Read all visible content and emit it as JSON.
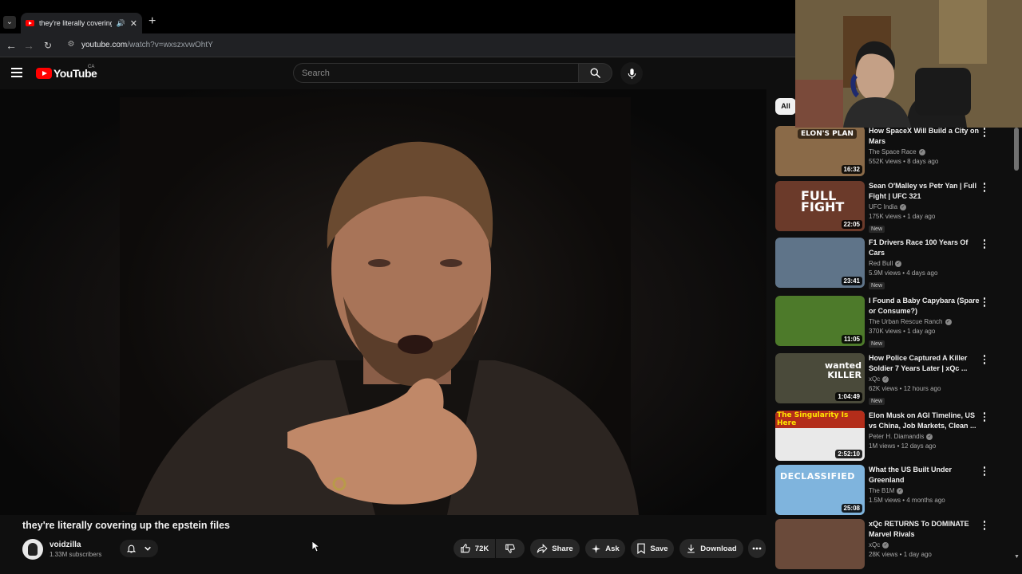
{
  "browser": {
    "tab_title": "they're literally covering up",
    "url_host": "youtube.com",
    "url_path": "/watch?v=wxszxvwOhtY"
  },
  "youtube": {
    "logo_text": "YouTube",
    "country_code": "CA",
    "search_placeholder": "Search"
  },
  "video": {
    "title": "they're literally covering up the epstein files",
    "channel_name": "voidzilla",
    "subscribers": "1.33M subscribers",
    "likes": "72K",
    "share_label": "Share",
    "ask_label": "Ask",
    "save_label": "Save",
    "download_label": "Download"
  },
  "sidebar": {
    "chip_all": "All",
    "items": [
      {
        "title": "How SpaceX Will Build a City on Mars",
        "channel": "The Space Race",
        "meta": "552K views • 8 days ago",
        "duration": "16:32",
        "new": false,
        "thumb_text": "ELON'S PLAN",
        "thumb_color": "#8a6a48"
      },
      {
        "title": "Sean O'Malley vs Petr Yan | Full Fight | UFC 321",
        "channel": "UFC India",
        "meta": "175K views • 1 day ago",
        "duration": "22:05",
        "new": true,
        "new_label": "New",
        "thumb_text": "FULL FIGHT",
        "thumb_color": "#6b3a2a"
      },
      {
        "title": "F1 Drivers Race 100 Years Of Cars",
        "channel": "Red Bull",
        "meta": "5.9M views • 4 days ago",
        "duration": "23:41",
        "new": true,
        "new_label": "New",
        "thumb_text": "",
        "thumb_color": "#5f7489"
      },
      {
        "title": "I Found a Baby Capybara (Spare or Consume?)",
        "channel": "The Urban Rescue Ranch",
        "meta": "370K views • 1 day ago",
        "duration": "11:05",
        "new": true,
        "new_label": "New",
        "thumb_text": "",
        "thumb_color": "#4d7a2a"
      },
      {
        "title": "How Police Captured A Killer Soldier 7 Years Later | xQc ...",
        "channel": "xQc",
        "meta": "62K views • 12 hours ago",
        "duration": "1:04:49",
        "new": true,
        "new_label": "New",
        "thumb_text": "wanted KILLER",
        "thumb_color": "#4a4a3a"
      },
      {
        "title": "Elon Musk on AGI Timeline, US vs China, Job Markets, Clean ...",
        "channel": "Peter H. Diamandis",
        "meta": "1M views • 12 days ago",
        "duration": "2:52:10",
        "new": false,
        "thumb_text": "The Singularity Is Here",
        "thumb_color": "#e9e9e9"
      },
      {
        "title": "What the US Built Under Greenland",
        "channel": "The B1M",
        "meta": "1.5M views • 4 months ago",
        "duration": "25:08",
        "new": false,
        "thumb_text": "DECLASSIFIED",
        "thumb_color": "#7fb4dd"
      },
      {
        "title": "xQc RETURNS To DOMINATE Marvel Rivals",
        "channel": "xQc",
        "meta": "28K views • 1 day ago",
        "duration": "",
        "new": false,
        "thumb_text": "",
        "thumb_color": "#6a4a3a"
      }
    ]
  }
}
